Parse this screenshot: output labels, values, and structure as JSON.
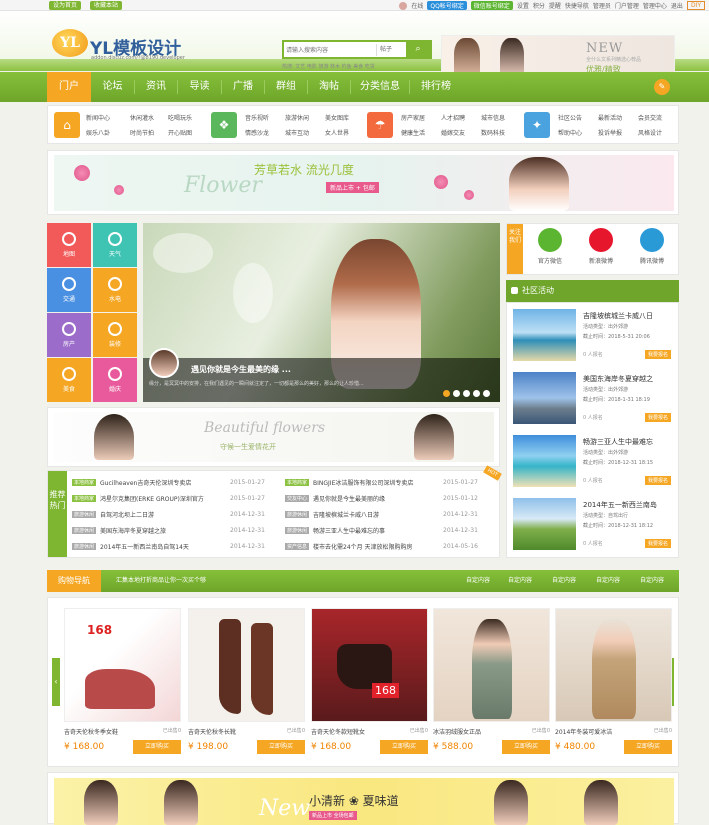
{
  "topbar": {
    "set_home": "设为首页",
    "bookmark": "收藏本站",
    "user": "在线",
    "qq_bind": "QQ帐号绑定",
    "wx_bind": "微信账号绑定",
    "links": [
      "设置",
      "积分",
      "提醒",
      "快捷导航",
      "管理员",
      "门户管理",
      "管理中心",
      "退出"
    ],
    "diy": "DIY"
  },
  "header": {
    "logo_mark": "YL",
    "logo_text": "YL模板设计",
    "logo_sub": "addon.discuz.com/?@8190.developer",
    "search_placeholder": "请输入搜索内容",
    "search_type": "帖子",
    "search_button": "⌕",
    "hot_words": "热搜: 文艺  电影  旅游  林木  钓鱼  美食  吃货",
    "banner_new": "NEW",
    "banner_small": "全什么文系列精选心荐品",
    "banner_tag": "优雅/精致"
  },
  "nav": {
    "items": [
      "门户",
      "论坛",
      "资讯",
      "导读",
      "广播",
      "群组",
      "淘帖",
      "分类信息",
      "排行榜"
    ],
    "icon": "✎"
  },
  "categories": {
    "groups": [
      {
        "icon": "⌂",
        "color": "#f5a623",
        "links": [
          "新闻中心",
          "休闲灌水",
          "吃喝玩乐",
          "娱乐八卦",
          "时尚节拍",
          "开心贴图"
        ]
      },
      {
        "icon": "❖",
        "color": "#5bb75b",
        "links": [
          "音乐视听",
          "旅游休闲",
          "美女图库",
          "情感沙龙",
          "城市互动",
          "女人世界"
        ]
      },
      {
        "icon": "☂",
        "color": "#f26a3d",
        "links": [
          "房产家居",
          "人才招聘",
          "城市信息",
          "健康生活",
          "婚嫁交友",
          "数码科技"
        ]
      },
      {
        "icon": "✦",
        "color": "#4aa3df",
        "links": [
          "社区公告",
          "最新活动",
          "会员交流",
          "帮助中心",
          "投诉举报",
          "风格设计"
        ]
      }
    ]
  },
  "banner1": {
    "title": "芳草若水  流光几度",
    "script": "Flower",
    "tag": "新品上市 + 包邮"
  },
  "tiles": [
    {
      "label": "地图",
      "color": "#f25a5a"
    },
    {
      "label": "天气",
      "color": "#3fc4b4"
    },
    {
      "label": "交通",
      "color": "#4a90e2"
    },
    {
      "label": "水电",
      "color": "#f5a623"
    },
    {
      "label": "房产",
      "color": "#9b6cc9"
    },
    {
      "label": "装修",
      "color": "#f5a623"
    },
    {
      "label": "美食",
      "color": "#f5a623"
    },
    {
      "label": "婚庆",
      "color": "#e85a9b"
    }
  ],
  "slider": {
    "caption": "遇见你就是今生最美的缘 ...",
    "desc": "缘分，是冥冥中的安排，在我们遇见的一瞬间就注定了，一切都是那么的美好，那么的让人珍惜..."
  },
  "banner2": {
    "script": "Beautiful flowers",
    "sub": "守候一生爱情花开"
  },
  "news": {
    "tag": "推荐热门",
    "hot": "HOT",
    "left": [
      {
        "label": "本地商家",
        "title": "Gucilheaven吉奇天伦深圳专卖店",
        "date": "2015-01-27"
      },
      {
        "label": "本地商家",
        "title": "鸿星尔克集团(ERKE GROUP)深圳官方",
        "date": "2015-01-27"
      },
      {
        "label": "旅游休闲",
        "title": "自驾河北坝上二日游",
        "date": "2014-12-31"
      },
      {
        "label": "旅游休闲",
        "title": "美国东海岸冬夏穿越之旅",
        "date": "2014-12-31"
      },
      {
        "label": "旅游休闲",
        "title": "2014年五一新西兰南岛自驾14天",
        "date": "2014-12-31"
      }
    ],
    "right": [
      {
        "label": "本地商家",
        "title": "BINGJIE冰洁服饰有限公司深圳专卖店",
        "date": "2015-01-27"
      },
      {
        "label": "交友中心",
        "title": "遇见你就是今生最美丽的缘",
        "date": "2015-01-12"
      },
      {
        "label": "旅游休闲",
        "title": "吉隆坡槟城兰卡威八日游",
        "date": "2014-12-31"
      },
      {
        "label": "旅游休闲",
        "title": "畅游三亚人生中最难忘的事",
        "date": "2014-12-31"
      },
      {
        "label": "资产信息",
        "title": "楼市去化需24个月 天津放松限购购房",
        "date": "2014-05-16"
      }
    ]
  },
  "follow": {
    "label": "关注我们",
    "items": [
      {
        "name": "官方微信",
        "color": "#5cb531"
      },
      {
        "name": "新浪微博",
        "color": "#e6162d"
      },
      {
        "name": "腾讯微博",
        "color": "#2a9ad7"
      }
    ]
  },
  "activity": {
    "title": "社区活动",
    "register_suffix": "人报名",
    "button": "我要报名",
    "items": [
      {
        "title": "吉隆坡槟城兰卡威八日",
        "type": "活动类型：出外郊游",
        "deadline": "截止时间：2018-5-31 20:06",
        "count": "0"
      },
      {
        "title": "美国东海岸冬夏穿越之",
        "type": "活动类型：出外郊游",
        "deadline": "截止时间：2018-1-31 18:19",
        "count": "0"
      },
      {
        "title": "畅游三亚人生中最难忘",
        "type": "活动类型：出外郊游",
        "deadline": "截止时间：2018-12-31 18:15",
        "count": "0"
      },
      {
        "title": "2014年五一新西兰南岛",
        "type": "活动类型：自驾出行",
        "deadline": "截止时间：2018-12-31 18:12",
        "count": "0"
      }
    ]
  },
  "shop": {
    "title": "购物导航",
    "sub": "汇集本地打折商品让你一次买个够",
    "links": [
      "自定内容",
      "自定内容",
      "自定内容",
      "自定内容",
      "自定内容"
    ],
    "buy": "立即购买",
    "sold": "已出售",
    "products": [
      {
        "name": "吉奇天伦秋冬季女鞋",
        "sold": "0",
        "price": "¥ 168.00"
      },
      {
        "name": "吉奇天伦秋冬长靴",
        "sold": "0",
        "price": "¥ 198.00"
      },
      {
        "name": "吉奇天伦冬款短靴女",
        "sold": "0",
        "price": "¥ 168.00"
      },
      {
        "name": "冰洁羽绒服女正品",
        "sold": "0",
        "price": "¥ 588.00"
      },
      {
        "name": "2014年冬装可爱冰洁",
        "sold": "0",
        "price": "¥ 480.00"
      }
    ]
  },
  "banner3": {
    "script": "New",
    "title": "小清新  ❀  夏味道",
    "tag": "新品上市 全场包邮"
  }
}
